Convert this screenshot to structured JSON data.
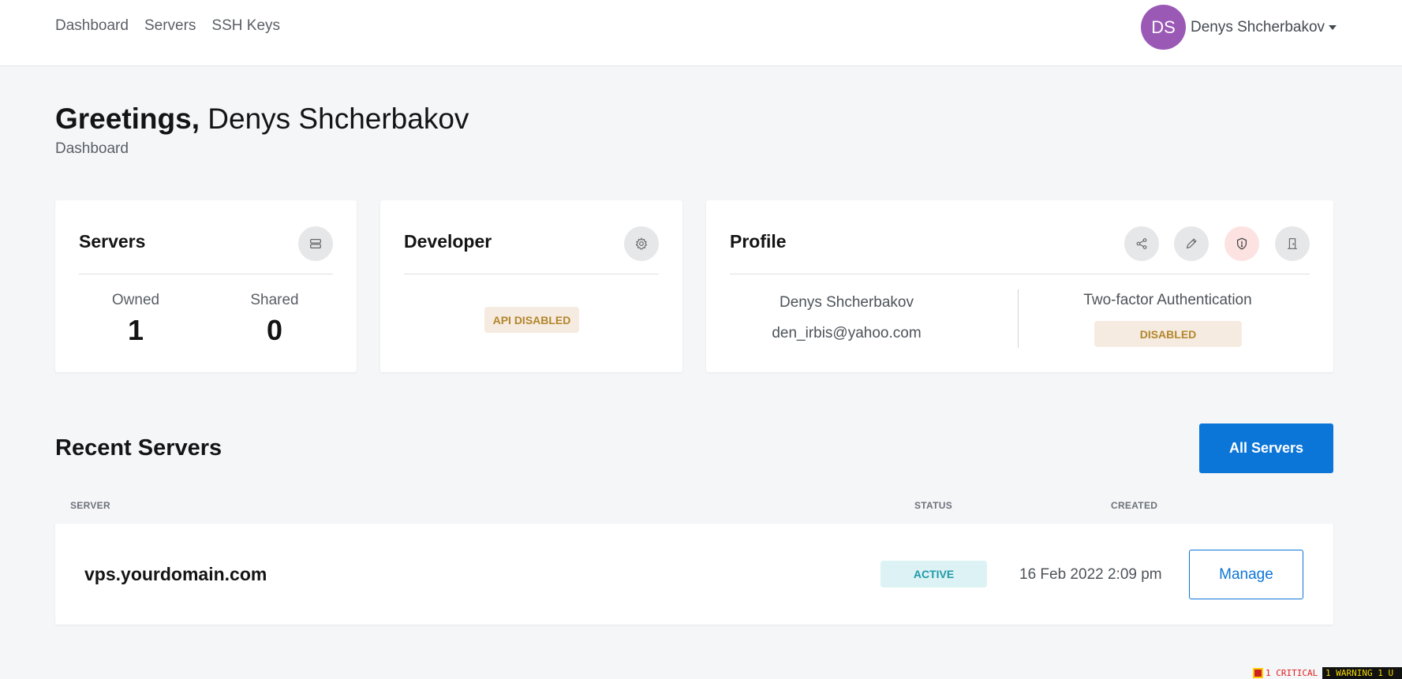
{
  "nav": {
    "links": [
      "Dashboard",
      "Servers",
      "SSH Keys"
    ],
    "user_initials": "DS",
    "user_name": "Denys Shcherbakov",
    "avatar_color": "#9b59b6"
  },
  "header": {
    "greeting": "Greetings,",
    "name": "Denys Shcherbakov",
    "subtitle": "Dashboard"
  },
  "servers_card": {
    "title": "Servers",
    "owned_label": "Owned",
    "owned_value": "1",
    "shared_label": "Shared",
    "shared_value": "0",
    "icon": "server-icon"
  },
  "developer_card": {
    "title": "Developer",
    "badge": "API DISABLED",
    "icon": "gear-icon"
  },
  "profile_card": {
    "title": "Profile",
    "name": "Denys Shcherbakov",
    "email": "den_irbis@yahoo.com",
    "tfa_label": "Two-factor Authentication",
    "tfa_badge": "DISABLED",
    "icons": [
      "share-icon",
      "pencil-icon",
      "shield-icon",
      "logout-door-icon"
    ]
  },
  "recent": {
    "title": "Recent Servers",
    "all_button": "All Servers",
    "columns": [
      "SERVER",
      "STATUS",
      "CREATED"
    ],
    "rows": [
      {
        "server": "vps.yourdomain.com",
        "status": "ACTIVE",
        "created": "16 Feb 2022 2:09 pm",
        "action": "Manage"
      }
    ]
  },
  "status_bar": {
    "critical": "1 CRITICAL",
    "warning": "1 WARNING  1 U"
  },
  "colors": {
    "accent": "#0c75d8",
    "warn_badge": "#b3862d",
    "active_badge": "#1f9aa8",
    "background": "#f5f6f8"
  }
}
